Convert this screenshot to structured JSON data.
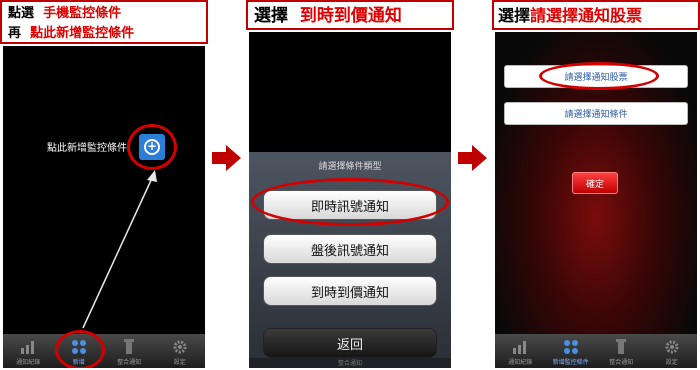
{
  "step1": {
    "header_line1_a": "點選",
    "header_line1_b": "手機監控條件",
    "header_line2_a": "再",
    "header_line2_b": "點此新增監控條件",
    "add_label": "點此新增監控條件",
    "add_symbol": "+",
    "tabs": [
      "通知紀錄",
      "新增",
      "整合通知",
      "設定"
    ]
  },
  "step2": {
    "header_a": "選擇",
    "header_b": "到時到價通知",
    "sheet_title": "請選擇條件類型",
    "options": [
      "即時訊號通知",
      "盤後訊號通知",
      "到時到價通知"
    ],
    "back": "返回",
    "tabs": [
      "",
      "",
      "整合通知",
      ""
    ]
  },
  "step3": {
    "header_a": "選擇",
    "header_b": "請選擇通知股票",
    "select_stock": "請選擇通知股票",
    "select_condition": "請選擇通知條件",
    "confirm": "確定",
    "tabs": [
      "通知紀錄",
      "新增監控條件",
      "整合通知",
      "設定"
    ]
  },
  "colors": {
    "accent_red": "#d40000",
    "header_red": "#e00000"
  },
  "icons": [
    "arrow-right-icon",
    "plus-circle-icon",
    "chart-icon",
    "nodes-icon",
    "tower-icon",
    "gear-icon"
  ]
}
